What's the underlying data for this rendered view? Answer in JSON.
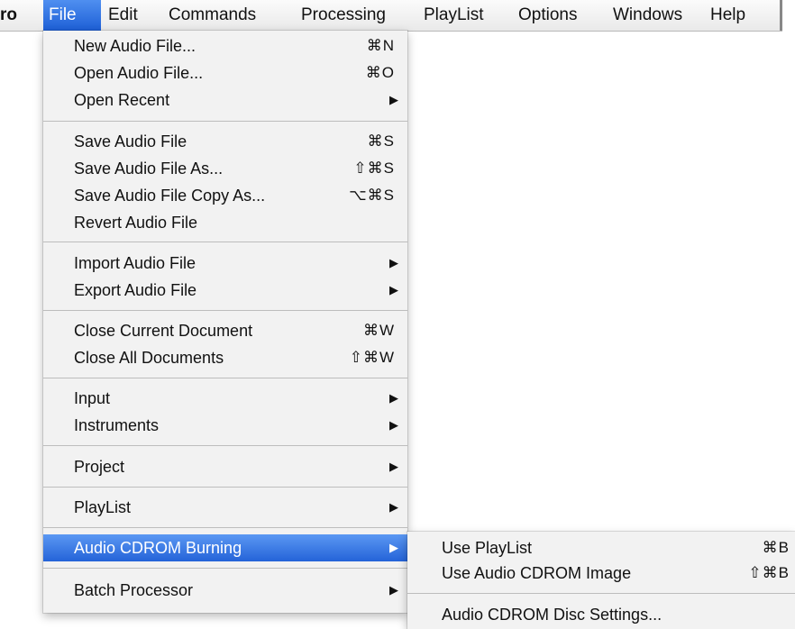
{
  "menubar": {
    "app": "ro",
    "items": [
      "File",
      "Edit",
      "Commands",
      "Processing",
      "PlayList",
      "Options",
      "Windows",
      "Help"
    ]
  },
  "file_menu": {
    "items": [
      {
        "label": "New Audio File...",
        "shortcut": "⌘N"
      },
      {
        "label": "Open Audio File...",
        "shortcut": "⌘O"
      },
      {
        "label": "Open Recent",
        "submenu": true
      },
      {
        "label": "Save Audio File",
        "shortcut": "⌘S"
      },
      {
        "label": "Save Audio File As...",
        "shortcut": "⇧⌘S"
      },
      {
        "label": "Save Audio File Copy As...",
        "shortcut": "⌥⌘S"
      },
      {
        "label": "Revert Audio File"
      },
      {
        "label": "Import Audio File",
        "submenu": true
      },
      {
        "label": "Export Audio File",
        "submenu": true
      },
      {
        "label": "Close Current Document",
        "shortcut": "⌘W"
      },
      {
        "label": "Close All Documents",
        "shortcut": "⇧⌘W"
      },
      {
        "label": "Input",
        "submenu": true
      },
      {
        "label": "Instruments",
        "submenu": true
      },
      {
        "label": "Project",
        "submenu": true
      },
      {
        "label": "PlayList",
        "submenu": true
      },
      {
        "label": "Audio CDROM Burning",
        "submenu": true,
        "highlighted": true
      },
      {
        "label": "Batch Processor",
        "submenu": true
      }
    ]
  },
  "submenu": {
    "items": [
      {
        "label": "Use PlayList",
        "shortcut": "⌘B"
      },
      {
        "label": "Use Audio CDROM Image",
        "shortcut": "⇧⌘B"
      },
      {
        "label": "Audio CDROM Disc Settings..."
      }
    ]
  },
  "glyphs": {
    "submenu_arrow": "▶"
  },
  "colors": {
    "highlight": "#2a6ad9",
    "menu_bg": "#f2f2f2"
  }
}
